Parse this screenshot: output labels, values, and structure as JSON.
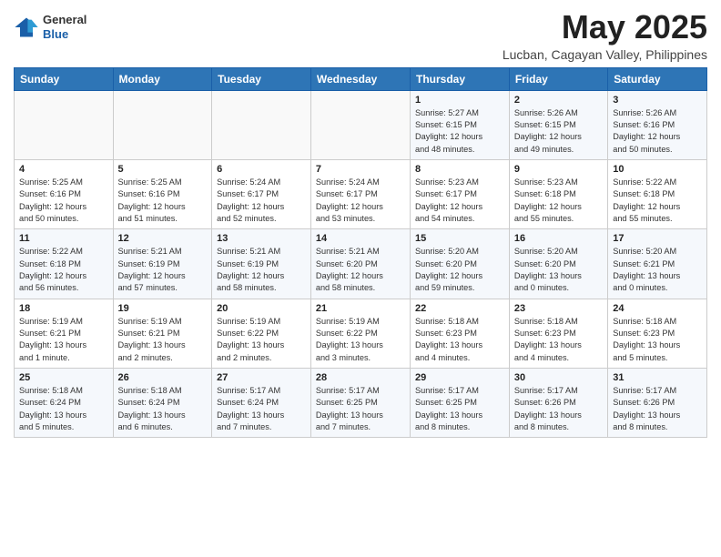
{
  "header": {
    "logo_general": "General",
    "logo_blue": "Blue",
    "month_title": "May 2025",
    "location": "Lucban, Cagayan Valley, Philippines"
  },
  "days_of_week": [
    "Sunday",
    "Monday",
    "Tuesday",
    "Wednesday",
    "Thursday",
    "Friday",
    "Saturday"
  ],
  "weeks": [
    [
      {
        "day": "",
        "info": ""
      },
      {
        "day": "",
        "info": ""
      },
      {
        "day": "",
        "info": ""
      },
      {
        "day": "",
        "info": ""
      },
      {
        "day": "1",
        "info": "Sunrise: 5:27 AM\nSunset: 6:15 PM\nDaylight: 12 hours\nand 48 minutes."
      },
      {
        "day": "2",
        "info": "Sunrise: 5:26 AM\nSunset: 6:15 PM\nDaylight: 12 hours\nand 49 minutes."
      },
      {
        "day": "3",
        "info": "Sunrise: 5:26 AM\nSunset: 6:16 PM\nDaylight: 12 hours\nand 50 minutes."
      }
    ],
    [
      {
        "day": "4",
        "info": "Sunrise: 5:25 AM\nSunset: 6:16 PM\nDaylight: 12 hours\nand 50 minutes."
      },
      {
        "day": "5",
        "info": "Sunrise: 5:25 AM\nSunset: 6:16 PM\nDaylight: 12 hours\nand 51 minutes."
      },
      {
        "day": "6",
        "info": "Sunrise: 5:24 AM\nSunset: 6:17 PM\nDaylight: 12 hours\nand 52 minutes."
      },
      {
        "day": "7",
        "info": "Sunrise: 5:24 AM\nSunset: 6:17 PM\nDaylight: 12 hours\nand 53 minutes."
      },
      {
        "day": "8",
        "info": "Sunrise: 5:23 AM\nSunset: 6:17 PM\nDaylight: 12 hours\nand 54 minutes."
      },
      {
        "day": "9",
        "info": "Sunrise: 5:23 AM\nSunset: 6:18 PM\nDaylight: 12 hours\nand 55 minutes."
      },
      {
        "day": "10",
        "info": "Sunrise: 5:22 AM\nSunset: 6:18 PM\nDaylight: 12 hours\nand 55 minutes."
      }
    ],
    [
      {
        "day": "11",
        "info": "Sunrise: 5:22 AM\nSunset: 6:18 PM\nDaylight: 12 hours\nand 56 minutes."
      },
      {
        "day": "12",
        "info": "Sunrise: 5:21 AM\nSunset: 6:19 PM\nDaylight: 12 hours\nand 57 minutes."
      },
      {
        "day": "13",
        "info": "Sunrise: 5:21 AM\nSunset: 6:19 PM\nDaylight: 12 hours\nand 58 minutes."
      },
      {
        "day": "14",
        "info": "Sunrise: 5:21 AM\nSunset: 6:20 PM\nDaylight: 12 hours\nand 58 minutes."
      },
      {
        "day": "15",
        "info": "Sunrise: 5:20 AM\nSunset: 6:20 PM\nDaylight: 12 hours\nand 59 minutes."
      },
      {
        "day": "16",
        "info": "Sunrise: 5:20 AM\nSunset: 6:20 PM\nDaylight: 13 hours\nand 0 minutes."
      },
      {
        "day": "17",
        "info": "Sunrise: 5:20 AM\nSunset: 6:21 PM\nDaylight: 13 hours\nand 0 minutes."
      }
    ],
    [
      {
        "day": "18",
        "info": "Sunrise: 5:19 AM\nSunset: 6:21 PM\nDaylight: 13 hours\nand 1 minute."
      },
      {
        "day": "19",
        "info": "Sunrise: 5:19 AM\nSunset: 6:21 PM\nDaylight: 13 hours\nand 2 minutes."
      },
      {
        "day": "20",
        "info": "Sunrise: 5:19 AM\nSunset: 6:22 PM\nDaylight: 13 hours\nand 2 minutes."
      },
      {
        "day": "21",
        "info": "Sunrise: 5:19 AM\nSunset: 6:22 PM\nDaylight: 13 hours\nand 3 minutes."
      },
      {
        "day": "22",
        "info": "Sunrise: 5:18 AM\nSunset: 6:23 PM\nDaylight: 13 hours\nand 4 minutes."
      },
      {
        "day": "23",
        "info": "Sunrise: 5:18 AM\nSunset: 6:23 PM\nDaylight: 13 hours\nand 4 minutes."
      },
      {
        "day": "24",
        "info": "Sunrise: 5:18 AM\nSunset: 6:23 PM\nDaylight: 13 hours\nand 5 minutes."
      }
    ],
    [
      {
        "day": "25",
        "info": "Sunrise: 5:18 AM\nSunset: 6:24 PM\nDaylight: 13 hours\nand 5 minutes."
      },
      {
        "day": "26",
        "info": "Sunrise: 5:18 AM\nSunset: 6:24 PM\nDaylight: 13 hours\nand 6 minutes."
      },
      {
        "day": "27",
        "info": "Sunrise: 5:17 AM\nSunset: 6:24 PM\nDaylight: 13 hours\nand 7 minutes."
      },
      {
        "day": "28",
        "info": "Sunrise: 5:17 AM\nSunset: 6:25 PM\nDaylight: 13 hours\nand 7 minutes."
      },
      {
        "day": "29",
        "info": "Sunrise: 5:17 AM\nSunset: 6:25 PM\nDaylight: 13 hours\nand 8 minutes."
      },
      {
        "day": "30",
        "info": "Sunrise: 5:17 AM\nSunset: 6:26 PM\nDaylight: 13 hours\nand 8 minutes."
      },
      {
        "day": "31",
        "info": "Sunrise: 5:17 AM\nSunset: 6:26 PM\nDaylight: 13 hours\nand 8 minutes."
      }
    ]
  ]
}
